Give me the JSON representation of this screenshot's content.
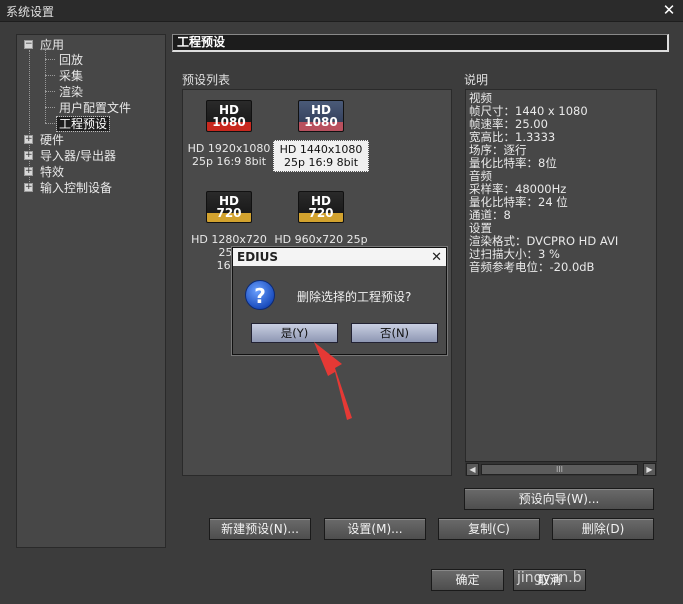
{
  "window": {
    "title": "系统设置",
    "close_glyph": "✕"
  },
  "tree": {
    "items": [
      {
        "label": "应用",
        "expander": "−"
      },
      {
        "label": "回放"
      },
      {
        "label": "采集"
      },
      {
        "label": "渲染"
      },
      {
        "label": "用户配置文件"
      },
      {
        "label": "工程预设"
      },
      {
        "label": "硬件",
        "expander": "+"
      },
      {
        "label": "导入器/导出器",
        "expander": "+"
      },
      {
        "label": "特效",
        "expander": "+"
      },
      {
        "label": "输入控制设备",
        "expander": "+"
      }
    ]
  },
  "header": {
    "title": "工程预设"
  },
  "presets": {
    "label": "预设列表",
    "items": [
      {
        "icon_top": "HD",
        "icon_bottom": "1080",
        "line1": "HD 1920x1080",
        "line2": "25p 16:9 8bit",
        "icon_style": "red"
      },
      {
        "icon_top": "HD",
        "icon_bottom": "1080",
        "line1": "HD 1440x1080",
        "line2": "25p 16:9 8bit",
        "icon_style": "pink",
        "selected": true
      },
      {
        "icon_top": "HD",
        "icon_bottom": "720",
        "line1": "HD 1280x720 25p",
        "line2": "16:9",
        "icon_style": "gold"
      },
      {
        "icon_top": "HD",
        "icon_bottom": "720",
        "line1": "HD 960x720 25p",
        "line2": "",
        "icon_style": "gold"
      }
    ]
  },
  "description": {
    "label": "说明",
    "lines": [
      "视频",
      " 帧尺寸：1440 x 1080",
      " 帧速率：25.00",
      "宽高比：1.3333",
      " 场序：逐行",
      "量化比特率：8位",
      "音频",
      "采样率：48000Hz",
      "量化比特率：24 位",
      " 通道：8",
      "设置",
      " 渲染格式：DVCPRO HD AVI",
      " 过扫描大小：3 %",
      " 音频参考电位：-20.0dB"
    ],
    "scroll_left": "◀",
    "scroll_right": "▶",
    "scroll_thumb": "III"
  },
  "buttons": {
    "preset_wizard": "预设向导(W)...",
    "new_preset": "新建预设(N)...",
    "settings": "设置(M)...",
    "copy": "复制(C)",
    "delete": "删除(D)",
    "ok": "确定",
    "cancel": "取消"
  },
  "dialog": {
    "title": "EDIUS",
    "close_glyph": "✕",
    "icon": "?",
    "message": "删除选择的工程预设?",
    "yes": "是(Y)",
    "no": "否(N)"
  },
  "watermark": "jingyan.b",
  "colors": {
    "annotation_arrow": "#e53935"
  }
}
